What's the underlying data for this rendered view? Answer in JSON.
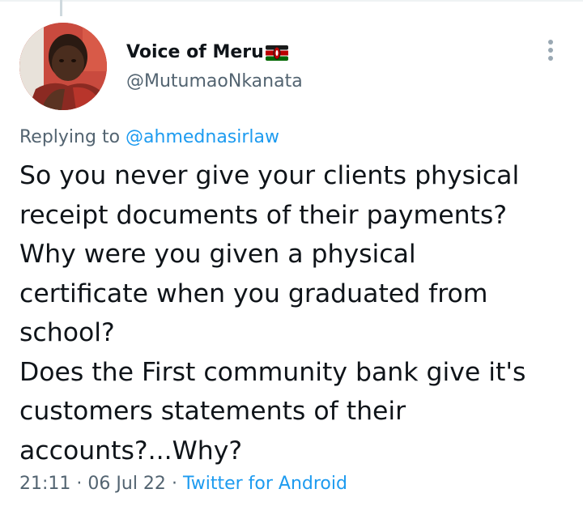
{
  "tweet": {
    "author": {
      "display_name": "Voice of Meru",
      "handle": "@MutumaoNkanata",
      "flag_icon": "kenya-flag-icon",
      "avatar_icon": "avatar-photo"
    },
    "reply": {
      "prefix": "Replying to",
      "target": "@ahmednasirlaw"
    },
    "text_lines": [
      "So you never give your clients physical",
      "receipt documents of their payments?",
      "Why were you given a physical",
      "certificate when you graduated from",
      "school?",
      "Does the First community bank give it's",
      "customers statements of their",
      "accounts?...Why?"
    ],
    "meta": {
      "time": "21:11",
      "separator_1": "·",
      "date": "06 Jul 22",
      "separator_2": "·",
      "source": "Twitter for Android"
    },
    "more_icon": "more-options-icon"
  },
  "colors": {
    "text_primary": "#0f1419",
    "text_secondary": "#536471",
    "link": "#1d9bf0",
    "thread_line": "#cfd9de"
  }
}
